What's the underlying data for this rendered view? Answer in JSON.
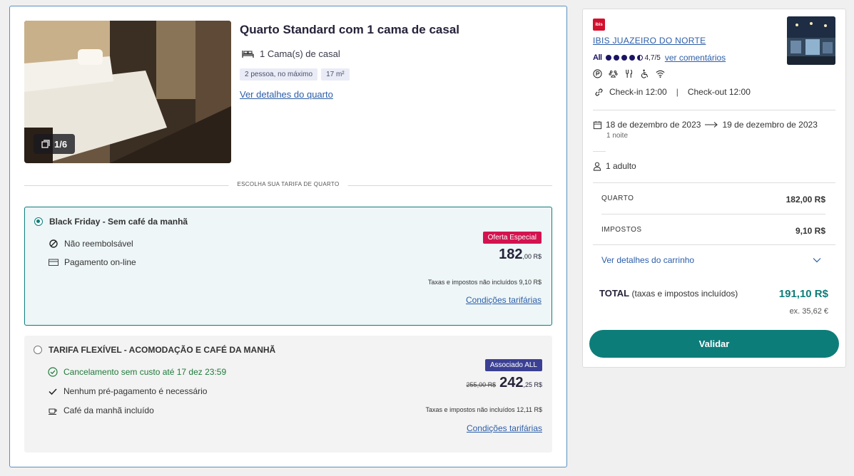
{
  "room": {
    "title": "Quarto Standard com 1 cama de casal",
    "beds": "1 Cama(s) de casal",
    "tags": [
      "2 pessoa, no máximo",
      "17 m²"
    ],
    "details_link": "Ver detalhes do quarto",
    "photo_counter": "1/6"
  },
  "rates_section_label": "ESCOLHA SUA TARIFA DE QUARTO",
  "rates": [
    {
      "name": "Black Friday - Sem café da manhã",
      "selected": true,
      "features": [
        "Não reembolsável",
        "Pagamento on-line"
      ],
      "badge": "Oferta Especial",
      "price_main": "182",
      "price_cents": ",00 R$",
      "taxes_prefix": "Taxas e impostos não incluídos 9",
      "taxes_value": ",10 R$",
      "conditions_link": "Condições tarifárias"
    },
    {
      "name": "TARIFA FLEXÍVEL - ACOMODAÇÃO E CAFÉ DA MANHÃ",
      "selected": false,
      "features": [
        "Cancelamento sem custo até 17 dez 23:59",
        "Nenhum pré-pagamento é necessário",
        "Café da manhã incluído"
      ],
      "badge": "Associado ALL",
      "old_price": "255,00 R$",
      "price_main": "242",
      "price_cents": ",25 R$",
      "taxes_prefix": "Taxas e impostos não incluídos 12",
      "taxes_value": ",11 R$",
      "conditions_link": "Condições tarifárias"
    }
  ],
  "summary": {
    "logo_text": "ibis",
    "hotel_name": "IBIS JUAZEIRO DO NORTE",
    "all_logo": "All",
    "rating": "4,7/5",
    "reviews_link": "ver comentários",
    "checkin": "Check-in 12:00",
    "checkin_sep": "|",
    "checkout": "Check-out 12:00",
    "date_from": "18 de dezembro de 2023",
    "date_to": "19 de dezembro de 2023",
    "nights": "1 noite",
    "guests": "1 adulto",
    "room_label": "QUARTO",
    "room_value": "182,00 R$",
    "taxes_label": "IMPOSTOS",
    "taxes_value": "9,10 R$",
    "cart_link": "Ver detalhes do carrinho",
    "total_label": "TOTAL",
    "total_note": "(taxas e impostos incluídos)",
    "total_value": "191,10 R$",
    "total_ex": "ex. 35,62 €",
    "validate_button": "Validar"
  },
  "colors": {
    "accent": "#0d7d7a",
    "link": "#2c5ea8",
    "special_badge": "#d3134f",
    "member_badge": "#3b4094"
  }
}
